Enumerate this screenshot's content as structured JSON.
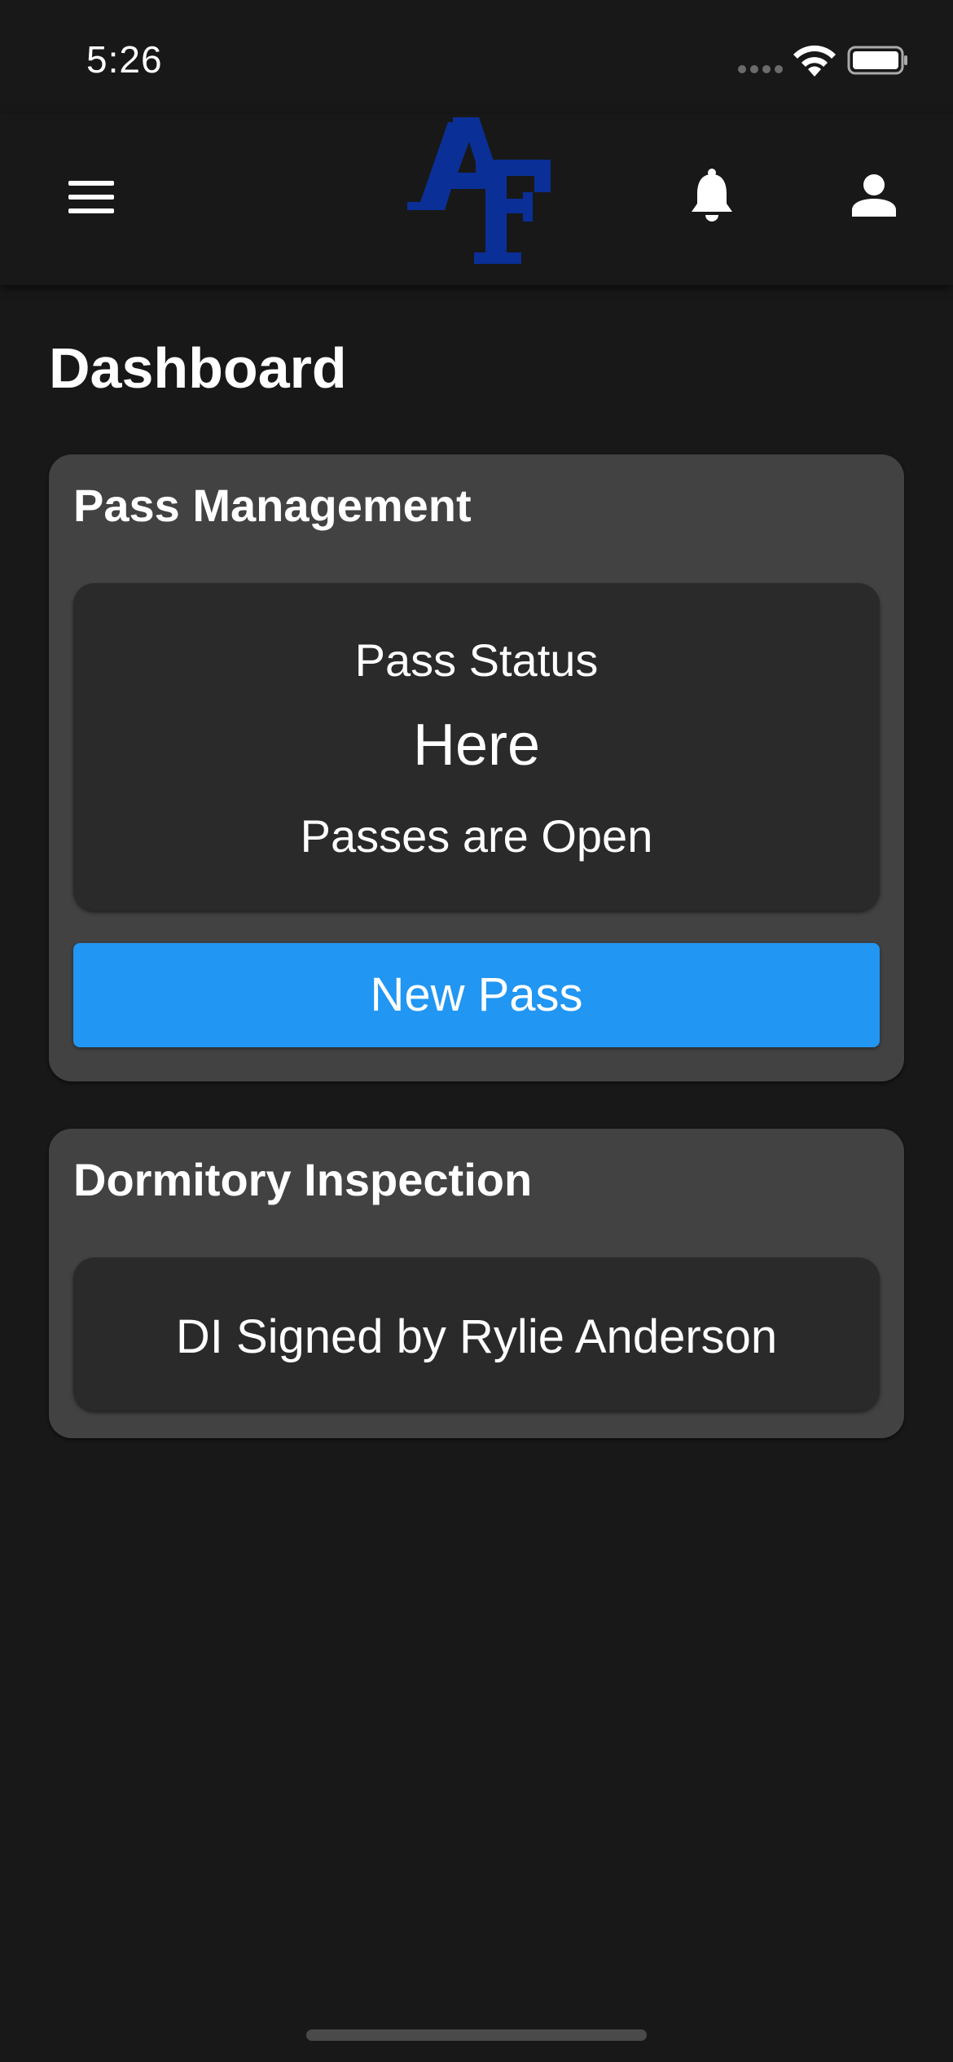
{
  "status_bar": {
    "time": "5:26",
    "icons": [
      "signal-icon",
      "wifi-icon",
      "battery-icon"
    ]
  },
  "header": {
    "logo_text": "AF",
    "logo_color": "#0a2f96",
    "icons": [
      "menu-icon",
      "bell-icon",
      "person-icon"
    ]
  },
  "page": {
    "title": "Dashboard"
  },
  "pass_management": {
    "title": "Pass Management",
    "status_label": "Pass Status",
    "status_value": "Here",
    "passes_state": "Passes are Open",
    "new_pass_label": "New Pass",
    "button_color": "#2196f3"
  },
  "dormitory_inspection": {
    "title": "Dormitory Inspection",
    "signed_text": "DI Signed by Rylie Anderson"
  }
}
